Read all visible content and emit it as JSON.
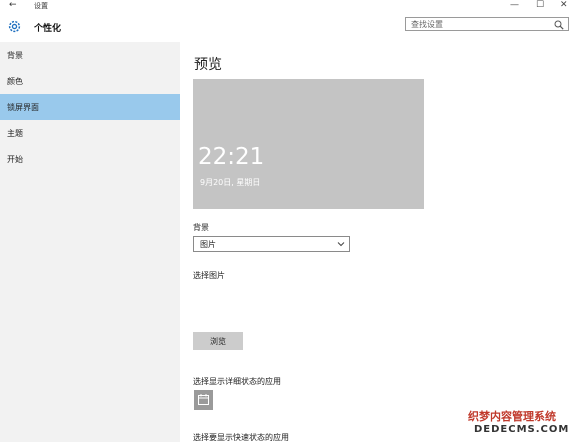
{
  "window": {
    "back_glyph": "←",
    "title": "设置",
    "minimize": "—",
    "maximize": "☐",
    "close": "✕"
  },
  "header": {
    "title": "个性化",
    "search_placeholder": "查找设置"
  },
  "sidebar": {
    "items": [
      {
        "label": "背景"
      },
      {
        "label": "颜色"
      },
      {
        "label": "锁屏界面"
      },
      {
        "label": "主题"
      },
      {
        "label": "开始"
      }
    ]
  },
  "main": {
    "preview_title": "预览",
    "preview_time": "22:21",
    "preview_date": "9月20日, 星期日",
    "background_label": "背景",
    "background_value": "图片",
    "choose_picture_label": "选择图片",
    "browse_label": "浏览",
    "detail_status_label": "选择显示详细状态的应用",
    "quick_status_label": "选择要显示快速状态的应用"
  },
  "watermark": {
    "line1": "织梦内容管理系统",
    "line2": "DEDECMS.COM"
  },
  "colors": {
    "accent_selected": "#99c9ec",
    "sidebar_bg": "#f2f2f2",
    "preview_bg": "#c4c4c4"
  }
}
